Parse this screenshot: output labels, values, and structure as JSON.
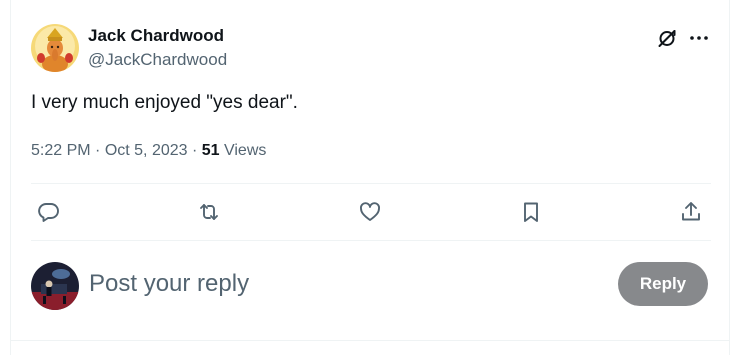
{
  "tweet": {
    "author_name": "Jack Chardwood",
    "author_handle": "@JackChardwood",
    "text": "I very much enjoyed \"yes dear\".",
    "time": "5:22 PM",
    "separator": " · ",
    "date": "Oct 5, 2023",
    "views_count": "51",
    "views_label": " Views"
  },
  "actions": {
    "reply_icon": "reply-icon",
    "retweet_icon": "retweet-icon",
    "like_icon": "heart-icon",
    "bookmark_icon": "bookmark-icon",
    "share_icon": "share-icon"
  },
  "reply": {
    "placeholder": "Post your reply",
    "button_label": "Reply"
  },
  "colors": {
    "text_primary": "#0f1419",
    "text_secondary": "#536471",
    "reply_button_bg": "#87898c",
    "divider": "#eff3f4"
  }
}
